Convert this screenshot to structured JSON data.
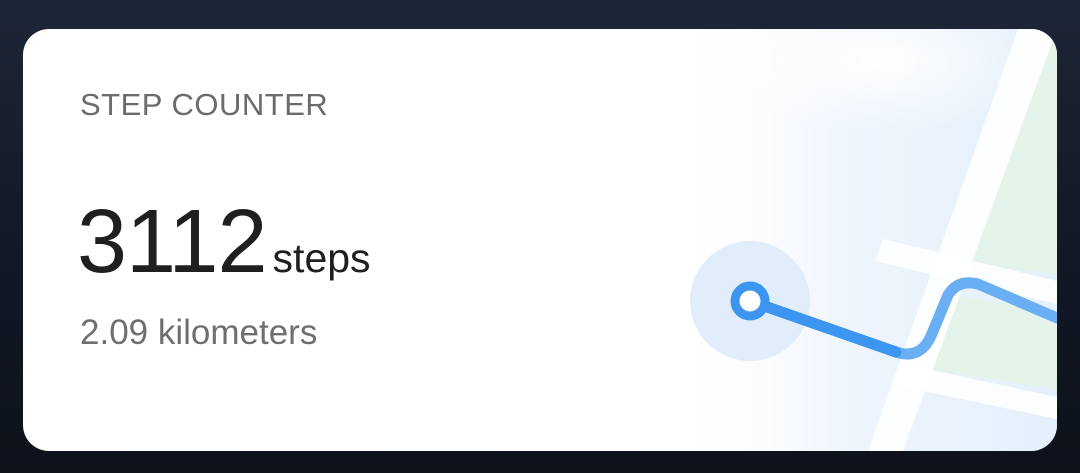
{
  "widget": {
    "title": "STEP COUNTER",
    "steps_value": "3112",
    "steps_unit": "steps",
    "distance": "2.09 kilometers"
  },
  "illustration": {
    "icon": "map-route-icon",
    "route_color": "#3d95f2",
    "halo_color": "#e3effb",
    "road_color": "#ffffff",
    "park_color": "#e6f4ea"
  },
  "colors": {
    "card_background": "#ffffff",
    "title_text": "#6b6b6b",
    "value_text": "#1f1f1f",
    "distance_text": "#6f6f6f"
  }
}
